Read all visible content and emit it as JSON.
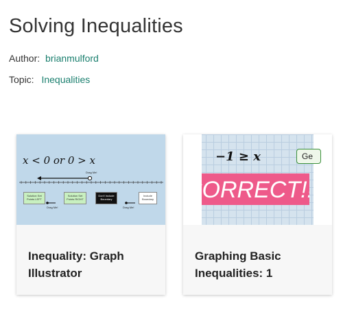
{
  "page": {
    "title": "Solving Inequalities"
  },
  "meta": {
    "author_label": "Author:",
    "author_value": "brianmulford",
    "topic_label": "Topic:",
    "topic_value": "Inequalities"
  },
  "cards": [
    {
      "title": "Inequality: Graph Illustrator",
      "thumb": {
        "math": "x < 0  or  0 > x",
        "drag_label": "Drag Me!",
        "boxes": [
          "Solution Set Points LEFT",
          "Solution Set Points RIGHT",
          "Don't Include Boundary",
          "Include Boundary"
        ],
        "drag_labels": [
          "Drag Me!",
          "Drag Me!"
        ]
      }
    },
    {
      "title": "Graphing Basic Inequalities: 1",
      "thumb": {
        "math": "−1 ≥ x",
        "banner": "CORRECT!!!",
        "button": "Ge"
      }
    }
  ],
  "colors": {
    "link": "#1a7f6e",
    "banner": "#ee5a8a",
    "thumb_bg": "#c0d8ea"
  }
}
